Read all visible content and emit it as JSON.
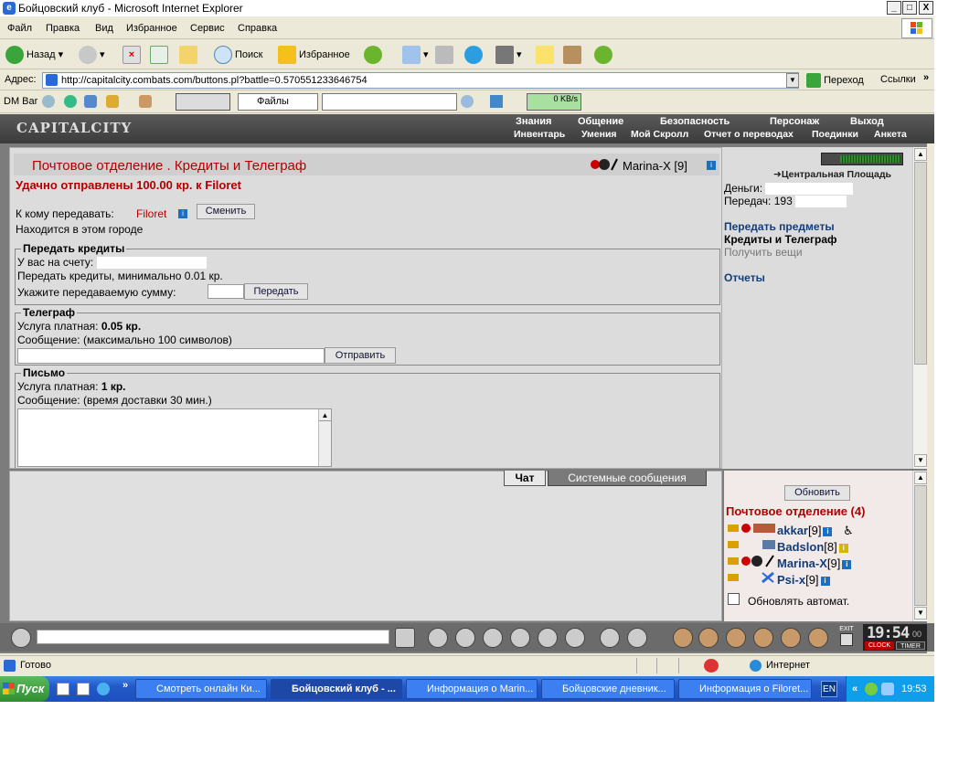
{
  "window": {
    "title": "Бойцовский клуб - Microsoft Internet Explorer",
    "min": "_",
    "max": "□",
    "close": "X"
  },
  "menubar": [
    "Файл",
    "Правка",
    "Вид",
    "Избранное",
    "Сервис",
    "Справка"
  ],
  "toolbar": {
    "back": "Назад",
    "search": "Поиск",
    "favorites": "Избранное"
  },
  "address": {
    "label": "Адрес:",
    "url": "http://capitalcity.combats.com/buttons.pl?battle=0.570551233646754",
    "go": "Переход",
    "links": "Ссылки"
  },
  "dmbar": {
    "label": "DM Bar",
    "files": "Файлы",
    "speed": "0 KB/s"
  },
  "site": {
    "logo": "CAPITALCITY",
    "nav_top": [
      "Знания",
      "Общение",
      "Безопасность",
      "Персонаж",
      "Выход"
    ],
    "nav_bottom": [
      "Инвентарь",
      "Умения",
      "Мой Скролл",
      "Отчет о переводах",
      "Поединки",
      "Анкета"
    ]
  },
  "main": {
    "header": "Почтовое отделение .  Кредиты и Телеграф",
    "user": "Marina-X",
    "user_level": "[9]",
    "success": "Удачно отправлены 100.00 кр. к Filoret",
    "recipient_label": "К кому передавать:",
    "recipient_name": "Filoret",
    "change_btn": "Сменить",
    "same_city": "Находится в этом городе",
    "credits": {
      "legend": "Передать кредиты",
      "balance_label": "У вас на счету:",
      "min_text": "Передать кредиты, минимально 0.01 кр.",
      "amount_label": "Укажите передаваемую сумму:",
      "send_btn": "Передать"
    },
    "telegraph": {
      "legend": "Телеграф",
      "paid_label": "Услуга платная:",
      "price": "0.05 кр.",
      "msg_label": "Сообщение: (максимально 100 символов)",
      "send_btn": "Отправить"
    },
    "letter": {
      "legend": "Письмо",
      "paid_label": "Услуга платная:",
      "price": "1 кр.",
      "msg_label": "Сообщение: (время доставки 30 мин.)"
    }
  },
  "side": {
    "location": "Центральная Площадь",
    "money_label": "Деньги:",
    "transfers_label": "Передач:",
    "transfers_value": "193",
    "links": [
      "Передать предметы",
      "Кредиты и Телеграф",
      "Получить вещи",
      "Отчеты"
    ]
  },
  "chat": {
    "tab_chat": "Чат",
    "tab_system": "Системные сообщения",
    "refresh_btn": "Обновить",
    "room": "Почтовое отделение (4)",
    "users": [
      {
        "name": "akkar",
        "level": "[9]"
      },
      {
        "name": "Badslon",
        "level": "[8]"
      },
      {
        "name": "Marina-X",
        "level": "[9]"
      },
      {
        "name": "Psi-x",
        "level": "[9]"
      }
    ],
    "auto_refresh": "Обновлять автомат."
  },
  "chatbar": {
    "clock": "19:54",
    "seconds": "00",
    "clock_label": "CLOCK",
    "timer_label": "TIMER",
    "exit": "EXIT"
  },
  "status": {
    "ready": "Готово",
    "zone": "Интернет"
  },
  "taskbar": {
    "start": "Пуск",
    "more": "»",
    "tasks": [
      "Смотреть онлайн Ки...",
      "Бойцовский клуб - ...",
      "Информация о Marin...",
      "Бойцовские дневник...",
      "Информация о Filoret..."
    ],
    "lang": "EN",
    "tray_more": "«",
    "time": "19:53"
  },
  "colors": {
    "header_red": "#b40000",
    "link_blue": "#123e7a",
    "panel_gray": "#dcdcdc",
    "taskbar_blue": "#2359c7"
  }
}
